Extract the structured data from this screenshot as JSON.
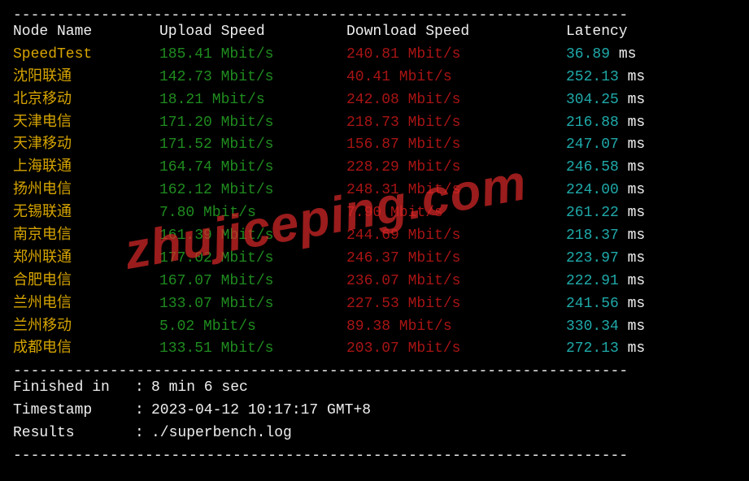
{
  "headers": {
    "name": "Node Name",
    "upload": "Upload Speed",
    "download": "Download Speed",
    "latency": "Latency"
  },
  "main_row": {
    "name": "SpeedTest",
    "upload": "185.41 Mbit/s",
    "download": "240.81 Mbit/s",
    "latency_val": "36.89",
    "latency_unit": " ms"
  },
  "rows": [
    {
      "name": "沈阳联通",
      "upload": "142.73 Mbit/s",
      "download": "40.41 Mbit/s",
      "latency_val": "252.13",
      "latency_unit": " ms"
    },
    {
      "name": "北京移动",
      "upload": "18.21 Mbit/s",
      "download": "242.08 Mbit/s",
      "latency_val": "304.25",
      "latency_unit": " ms"
    },
    {
      "name": "天津电信",
      "upload": "171.20 Mbit/s",
      "download": "218.73 Mbit/s",
      "latency_val": "216.88",
      "latency_unit": " ms"
    },
    {
      "name": "天津移动",
      "upload": "171.52 Mbit/s",
      "download": "156.87 Mbit/s",
      "latency_val": "247.07",
      "latency_unit": " ms"
    },
    {
      "name": "上海联通",
      "upload": "164.74 Mbit/s",
      "download": "228.29 Mbit/s",
      "latency_val": "246.58",
      "latency_unit": " ms"
    },
    {
      "name": "扬州电信",
      "upload": "162.12 Mbit/s",
      "download": "248.31 Mbit/s",
      "latency_val": "224.00",
      "latency_unit": " ms"
    },
    {
      "name": "无锡联通",
      "upload": "7.80 Mbit/s",
      "download": "7.90 Mbit/s",
      "latency_val": "261.22",
      "latency_unit": " ms"
    },
    {
      "name": "南京电信",
      "upload": "161.39 Mbit/s",
      "download": "244.69 Mbit/s",
      "latency_val": "218.37",
      "latency_unit": " ms"
    },
    {
      "name": "郑州联通",
      "upload": "177.02 Mbit/s",
      "download": "246.37 Mbit/s",
      "latency_val": "223.97",
      "latency_unit": " ms"
    },
    {
      "name": "合肥电信",
      "upload": "167.07 Mbit/s",
      "download": "236.07 Mbit/s",
      "latency_val": "222.91",
      "latency_unit": " ms"
    },
    {
      "name": "兰州电信",
      "upload": "133.07 Mbit/s",
      "download": "227.53 Mbit/s",
      "latency_val": "241.56",
      "latency_unit": " ms"
    },
    {
      "name": "兰州移动",
      "upload": "5.02 Mbit/s",
      "download": "89.38 Mbit/s",
      "latency_val": "330.34",
      "latency_unit": " ms"
    },
    {
      "name": "成都电信",
      "upload": "133.51 Mbit/s",
      "download": "203.07 Mbit/s",
      "latency_val": "272.13",
      "latency_unit": " ms"
    }
  ],
  "footer": {
    "finished_label": "Finished in",
    "finished_value": "8 min 6 sec",
    "timestamp_label": "Timestamp",
    "timestamp_value": "2023-04-12 10:17:17 GMT+8",
    "results_label": "Results",
    "results_value": "./superbench.log",
    "sep": ": "
  },
  "divider": "----------------------------------------------------------------------",
  "watermark": "zhujiceping.com"
}
